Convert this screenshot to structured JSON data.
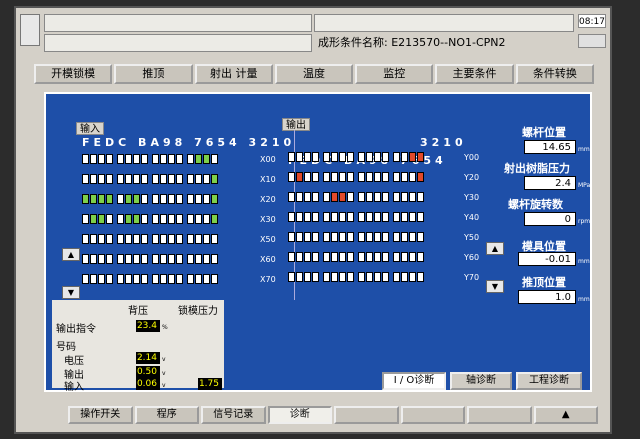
{
  "time": "08:17",
  "header": {
    "condition_label": "成形条件名称:",
    "condition_name": "E213570--NO1-CPN2"
  },
  "tabs": [
    "开模锁模",
    "推顶",
    "射出 计量",
    "温度",
    "监控",
    "主要条件",
    "条件转换"
  ],
  "io": {
    "input_label": "输入",
    "output_label": "输出",
    "input_bit_header": "FEDC BA98 7654 3210",
    "output_bit_header_left": "FEDC BA98 7654",
    "output_bit_header_right": "3210",
    "input_rows": [
      {
        "addr": "X00",
        "bits": "0000 0000 0000 0110"
      },
      {
        "addr": "X10",
        "bits": "0000 0000 0000 0001"
      },
      {
        "addr": "X20",
        "bits": "1111 0110 0000 0001"
      },
      {
        "addr": "X30",
        "bits": "0110 0110 0000 0001"
      },
      {
        "addr": "X50",
        "bits": "0000 0000 0000 0000"
      },
      {
        "addr": "X60",
        "bits": "0000 0000 0000 0000"
      },
      {
        "addr": "X70",
        "bits": "0000 0000 0000 0000"
      }
    ],
    "output_rows": [
      {
        "addr": "Y00",
        "bits": "0000 0000 0000 0011"
      },
      {
        "addr": "Y20",
        "bits": "0100 0000 0000 0001"
      },
      {
        "addr": "Y30",
        "bits": "0000 0110 0000 0000"
      },
      {
        "addr": "Y40",
        "bits": "0000 0000 0000 0000"
      },
      {
        "addr": "Y50",
        "bits": "0000 0000 0000 0000"
      },
      {
        "addr": "Y60",
        "bits": "0000 0000 0000 0000"
      },
      {
        "addr": "Y70",
        "bits": "0000 0000 0000 0000"
      }
    ]
  },
  "right": [
    {
      "label": "螺杆位置",
      "value": "14.65",
      "unit": "mm"
    },
    {
      "label": "射出树脂压力",
      "value": "2.4",
      "unit": "MPa"
    },
    {
      "label": "螺杆旋转数",
      "value": "0",
      "unit": "rpm"
    },
    {
      "label": "模具位置",
      "value": "-0.01",
      "unit": "mm"
    },
    {
      "label": "推顶位置",
      "value": "1.0",
      "unit": "mm"
    }
  ],
  "info": {
    "col1": "背压",
    "col2": "锁模压力",
    "output_cmd": "输出指令",
    "output_cmd_value": "23.4",
    "output_cmd_unit": "%",
    "signal": "号码",
    "voltage": "电压",
    "voltage_value": "2.14",
    "output": "输出",
    "output_value": "0.50",
    "input": "输入",
    "input_value": "0.06",
    "input_value2": "1.75",
    "v": "v"
  },
  "diag_tabs": [
    "I / O诊断",
    "轴诊断",
    "工程诊断"
  ],
  "bottom_tabs": [
    "操作开关",
    "程序",
    "信号记录",
    "诊断",
    "",
    "",
    "",
    "▲"
  ]
}
